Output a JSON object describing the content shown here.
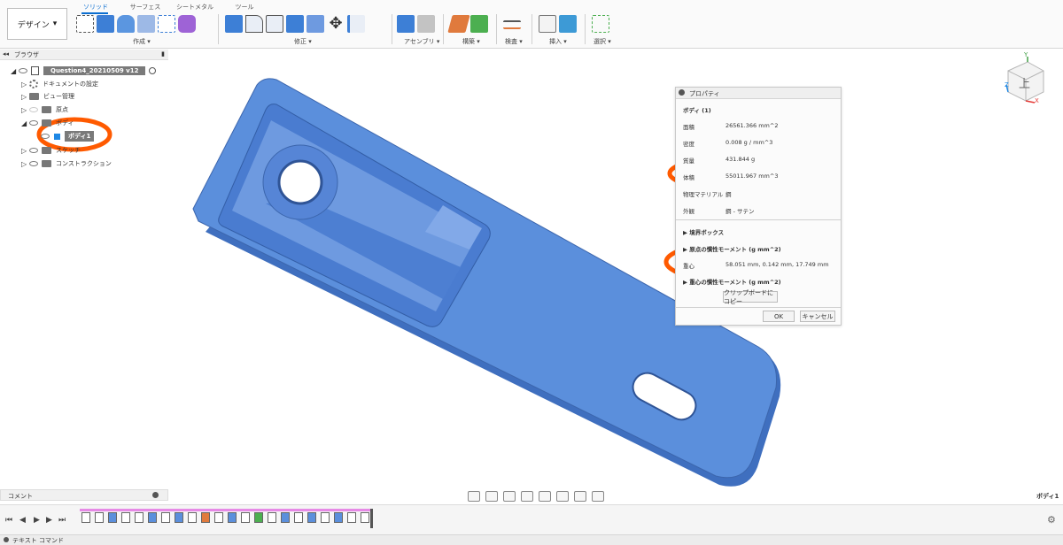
{
  "toolbar": {
    "design_label": "デザイン",
    "tabs": [
      "ソリッド",
      "サーフェス",
      "シートメタル",
      "ツール"
    ],
    "groups": [
      "作成",
      "修正",
      "アセンブリ",
      "構築",
      "検査",
      "挿入",
      "選択"
    ]
  },
  "browser": {
    "title": "ブラウザ",
    "root": "Question4_20210509 v12",
    "items": [
      "ドキュメントの設定",
      "ビュー管理",
      "原点",
      "ボディ",
      "ボディ1",
      "スケッチ",
      "コンストラクション"
    ]
  },
  "viewcube": {
    "face": "上",
    "axis_x": "X",
    "axis_y": "Y",
    "axis_z": "Z"
  },
  "properties": {
    "title": "プロパティ",
    "selection": "ボディ (1)",
    "rows": [
      {
        "label": "面積",
        "value": "26561.366 mm^2"
      },
      {
        "label": "密度",
        "value": "0.008 g / mm^3"
      },
      {
        "label": "質量",
        "value": "431.844 g"
      },
      {
        "label": "体積",
        "value": "55011.967 mm^3"
      },
      {
        "label": "物理マテリアル",
        "value": "鋼"
      },
      {
        "label": "外観",
        "value": "鋼 - サテン"
      }
    ],
    "sections": [
      "境界ボックス",
      "原点の慣性モーメント (g mm^2)",
      "重心の慣性モーメント (g mm^2)"
    ],
    "center_of_mass": {
      "label": "重心",
      "value": "58.051 mm, 0.142 mm, 17.749 mm"
    },
    "copy_button": "クリップボードにコピー",
    "ok_button": "OK",
    "cancel_button": "キャンセル"
  },
  "comments": {
    "title": "コメント"
  },
  "status": {
    "selection": "ボディ1"
  },
  "text_command": "テキスト コマンド",
  "colors": {
    "part": "#5b8fdc",
    "highlight": "#ff5a00",
    "accent": "#0b6ed0"
  }
}
